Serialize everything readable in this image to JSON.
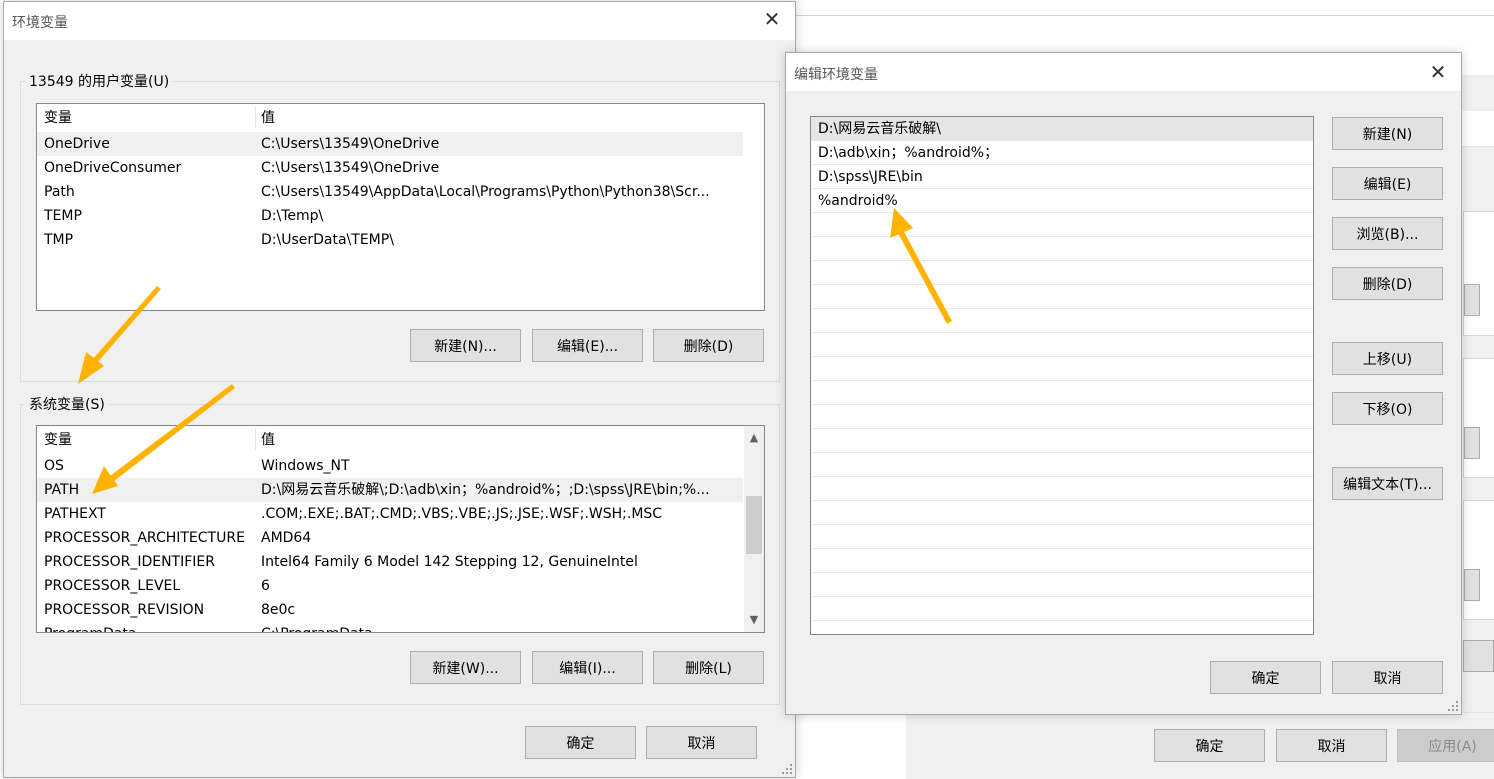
{
  "env_dialog": {
    "title": "环境变量",
    "user_group_label": "13549 的用户变量(U)",
    "user_table": {
      "headers": [
        "变量",
        "值"
      ],
      "rows": [
        {
          "name": "OneDrive",
          "value": "C:\\Users\\13549\\OneDrive"
        },
        {
          "name": "OneDriveConsumer",
          "value": "C:\\Users\\13549\\OneDrive"
        },
        {
          "name": "Path",
          "value": "C:\\Users\\13549\\AppData\\Local\\Programs\\Python\\Python38\\Scr..."
        },
        {
          "name": "TEMP",
          "value": "D:\\Temp\\"
        },
        {
          "name": "TMP",
          "value": "D:\\UserData\\TEMP\\"
        }
      ]
    },
    "user_buttons": {
      "new": "新建(N)...",
      "edit": "编辑(E)...",
      "delete": "删除(D)"
    },
    "system_group_label": "系统变量(S)",
    "system_table": {
      "headers": [
        "变量",
        "值"
      ],
      "rows": [
        {
          "name": "OS",
          "value": "Windows_NT"
        },
        {
          "name": "PATH",
          "value": "D:\\网易云音乐破解\\;D:\\adb\\xin；%android%；;D:\\spss\\JRE\\bin;%..."
        },
        {
          "name": "PATHEXT",
          "value": ".COM;.EXE;.BAT;.CMD;.VBS;.VBE;.JS;.JSE;.WSF;.WSH;.MSC"
        },
        {
          "name": "PROCESSOR_ARCHITECTURE",
          "value": "AMD64"
        },
        {
          "name": "PROCESSOR_IDENTIFIER",
          "value": "Intel64 Family 6 Model 142 Stepping 12, GenuineIntel"
        },
        {
          "name": "PROCESSOR_LEVEL",
          "value": "6"
        },
        {
          "name": "PROCESSOR_REVISION",
          "value": "8e0c"
        },
        {
          "name": "ProgramData",
          "value": "C:\\ProgramData"
        }
      ]
    },
    "system_buttons": {
      "new": "新建(W)...",
      "edit": "编辑(I)...",
      "delete": "删除(L)"
    },
    "ok": "确定",
    "cancel": "取消"
  },
  "edit_dialog": {
    "title": "编辑环境变量",
    "entries": [
      "D:\\网易云音乐破解\\",
      "D:\\adb\\xin；%android%；",
      "D:\\spss\\JRE\\bin",
      "%android%"
    ],
    "buttons": {
      "new": "新建(N)",
      "edit": "编辑(E)",
      "browse": "浏览(B)...",
      "delete": "删除(D)",
      "up": "上移(U)",
      "down": "下移(O)",
      "edit_text": "编辑文本(T)..."
    },
    "ok": "确定",
    "cancel": "取消"
  },
  "background_window": {
    "ok": "确定",
    "cancel": "取消",
    "apply": "应用(A)"
  },
  "annotation_color": "#FFB300"
}
